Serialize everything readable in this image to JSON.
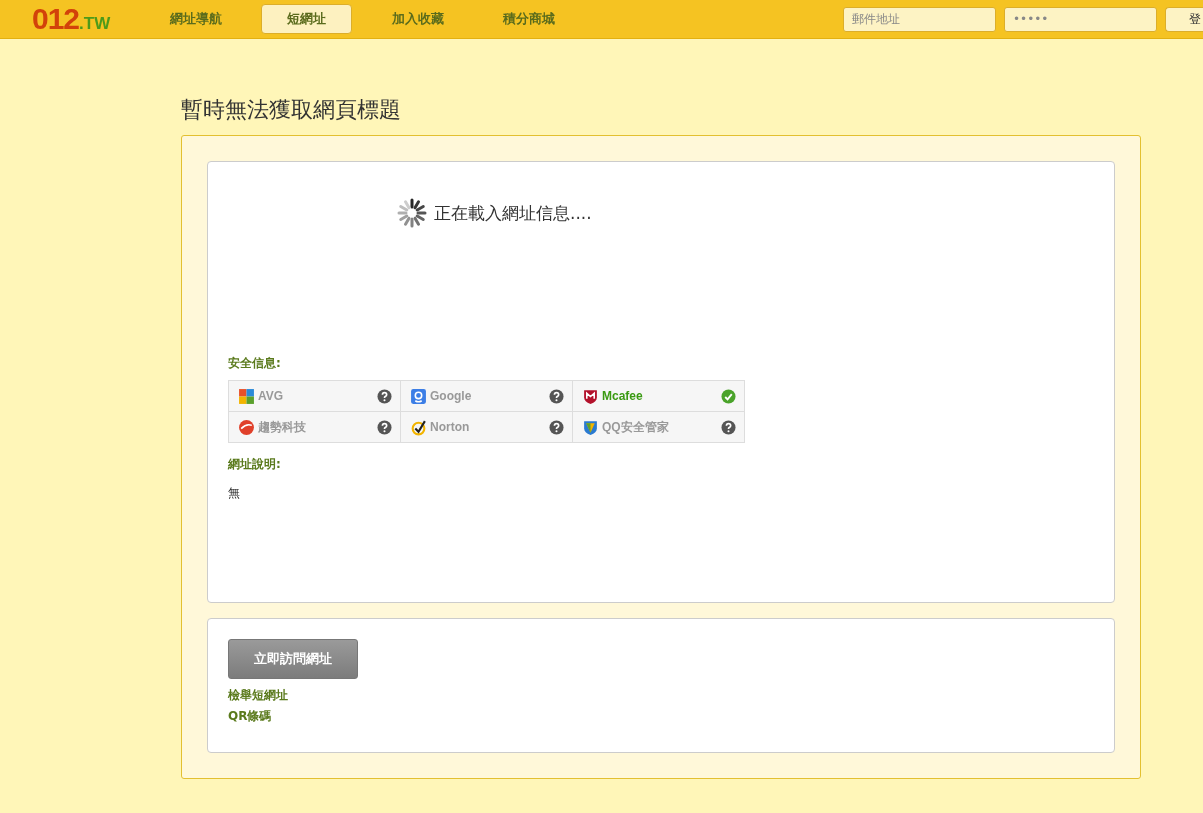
{
  "header": {
    "logo": {
      "digits": "012",
      "suffix": ".TW"
    },
    "nav": [
      {
        "label": "網址導航",
        "selected": false
      },
      {
        "label": "短網址",
        "selected": true
      },
      {
        "label": "加入收藏",
        "selected": false
      },
      {
        "label": "積分商城",
        "selected": false
      }
    ],
    "email_field": {
      "placeholder": "郵件地址"
    },
    "password_field": {
      "placeholder": "•••••"
    },
    "login_button": "登"
  },
  "page_title": "暫時無法獲取網頁標題",
  "loading_text": "正在載入網址信息....",
  "security": {
    "heading": "安全信息:",
    "vendors": [
      {
        "name": "AVG",
        "kind": "avg",
        "safe": false
      },
      {
        "name": "Google",
        "kind": "google",
        "safe": false
      },
      {
        "name": "Mcafee",
        "kind": "mcafee",
        "safe": true
      },
      {
        "name": "趨勢科技",
        "kind": "trend",
        "safe": false
      },
      {
        "name": "Norton",
        "kind": "norton",
        "safe": false
      },
      {
        "name": "QQ安全管家",
        "kind": "qq",
        "safe": false
      }
    ]
  },
  "description": {
    "heading": "網址說明:",
    "text": "無"
  },
  "visit_button": "立即訪問網址",
  "links": [
    "檢舉短網址",
    "QR條碼"
  ]
}
